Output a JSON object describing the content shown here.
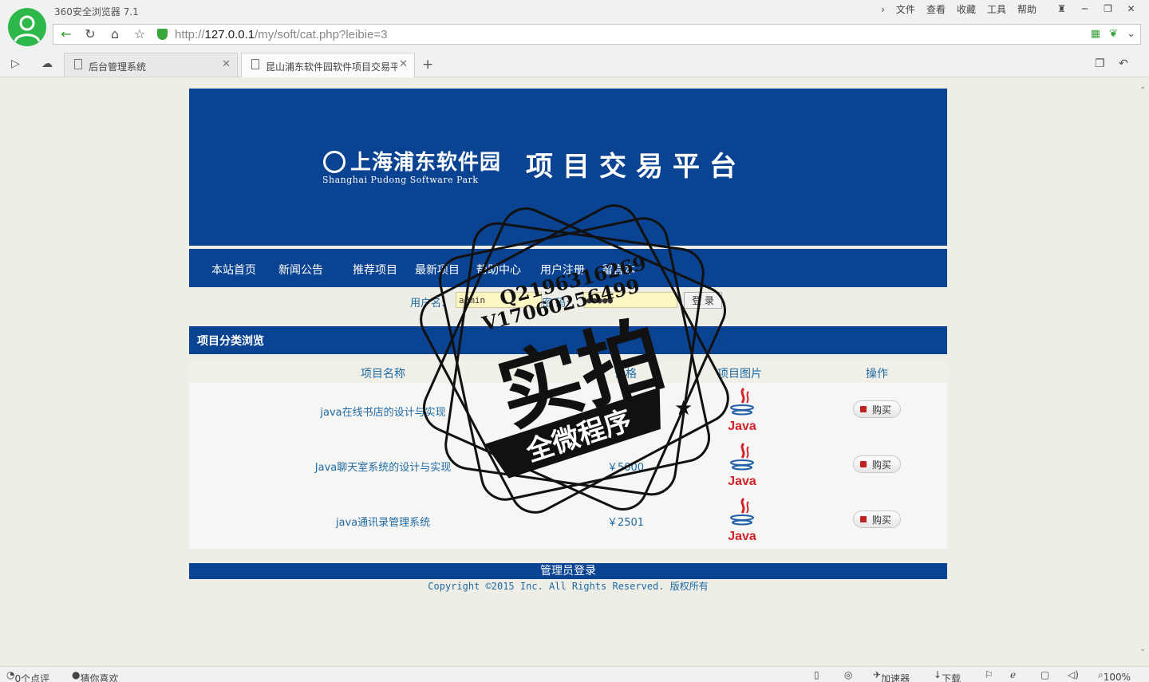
{
  "browser": {
    "app_title": "360安全浏览器 7.1",
    "menu": [
      "文件",
      "查看",
      "收藏",
      "工具",
      "帮助"
    ],
    "url_prefix": "http://",
    "url_host": "127.0.0.1",
    "url_path": "/my/soft/cat.php?leibie=3",
    "tabs": [
      {
        "label": "后台管理系统"
      },
      {
        "label": "昆山浦东软件园软件项目交易平"
      }
    ]
  },
  "site": {
    "logo_cn": "上海浦东软件园",
    "logo_en": "Shanghai Pudong Software Park",
    "platform_title": "项目交易平台",
    "nav": [
      "本站首页",
      "新闻公告",
      "推荐项目",
      "最新项目",
      "帮助中心",
      "用户注册",
      "留言本"
    ],
    "login": {
      "username_label": "用户名:",
      "username_value": "admin",
      "password_label": "密 码:",
      "password_value": "●●●●●",
      "submit_label": "登 录"
    },
    "section_title": "项目分类浏览",
    "table": {
      "headers": [
        "项目名称",
        "价格",
        "项目图片",
        "操作"
      ],
      "rows": [
        {
          "name": "java在线书店的设计与实现",
          "price": "",
          "image": "Java",
          "action": "购买"
        },
        {
          "name": "Java聊天室系统的设计与实现",
          "price": "￥5000",
          "image": "Java",
          "action": "购买"
        },
        {
          "name": "java通讯录管理系统",
          "price": "￥2501",
          "image": "Java",
          "action": "购买"
        }
      ]
    },
    "footer_link": "管理员登录",
    "copyright": "Copyright ©2015 Inc. All Rights Reserved. 版权所有"
  },
  "watermark": {
    "line1": "Q2196316269",
    "line2": "V17060256499",
    "main": "实拍",
    "ribbon": "全微程序"
  },
  "status_bar": {
    "reviews": "0个点评",
    "recommend": "猜你喜欢",
    "accelerator": "加速器",
    "download": "下载",
    "zoom": "100%"
  },
  "colors": {
    "brand_blue": "#0b4393",
    "link_blue": "#1f6aa5",
    "page_bg": "#eeeee6"
  }
}
